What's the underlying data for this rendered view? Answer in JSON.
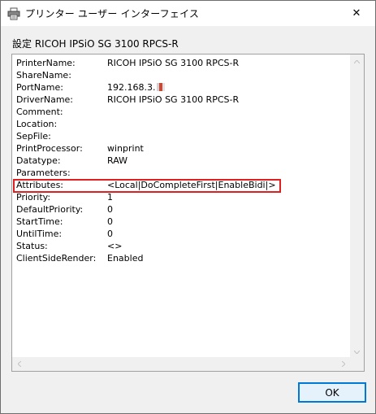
{
  "window": {
    "title": "プリンター ユーザー インターフェイス",
    "close_glyph": "✕"
  },
  "section_label": "設定 RICOH IPSiO SG 3100 RPCS-R",
  "properties": [
    {
      "key": "PrinterName:",
      "value": "RICOH IPSiO SG 3100 RPCS-R"
    },
    {
      "key": "ShareName:",
      "value": ""
    },
    {
      "key": "PortName:",
      "value": "192.168.3."
    },
    {
      "key": "DriverName:",
      "value": "RICOH IPSiO SG 3100 RPCS-R"
    },
    {
      "key": "Comment:",
      "value": ""
    },
    {
      "key": "Location:",
      "value": ""
    },
    {
      "key": "SepFile:",
      "value": ""
    },
    {
      "key": "PrintProcessor:",
      "value": "winprint"
    },
    {
      "key": "Datatype:",
      "value": "RAW"
    },
    {
      "key": "Parameters:",
      "value": ""
    },
    {
      "key": "Attributes:",
      "value": "<Local|DoCompleteFirst|EnableBidi|>"
    },
    {
      "key": "Priority:",
      "value": "1"
    },
    {
      "key": "DefaultPriority:",
      "value": "0"
    },
    {
      "key": "StartTime:",
      "value": "0"
    },
    {
      "key": "UntilTime:",
      "value": "0"
    },
    {
      "key": "Status:",
      "value": "<>"
    },
    {
      "key": "ClientSideRender:",
      "value": "Enabled"
    }
  ],
  "highlight_color": "#e02020",
  "ok_label": "OK"
}
